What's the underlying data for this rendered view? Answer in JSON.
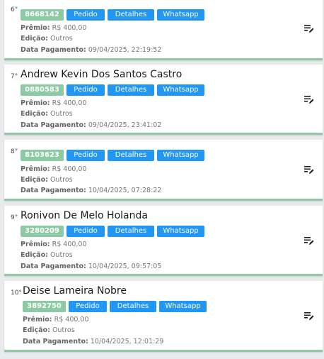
{
  "labels": {
    "premio": "Prêmio:",
    "edicao": "Edição:",
    "data_pagamento": "Data Pagamento:"
  },
  "buttons": {
    "pedido": "Pedido",
    "detalhes": "Detalhes",
    "whatsapp": "Whatsapp"
  },
  "colors": {
    "code_chip": "#8ccaa4",
    "button": "#2196f3",
    "card_border": "#8fc9a6"
  },
  "entries": [
    {
      "rank": "6°",
      "name": "",
      "code": "8668142",
      "premio": "R$ 400,00",
      "edicao": "Outros",
      "data_pagamento": "09/04/2025, 22:19:52"
    },
    {
      "rank": "7°",
      "name": "Andrew Kevin Dos Santos Castro",
      "code": "0880583",
      "premio": "R$ 400,00",
      "edicao": "Outros",
      "data_pagamento": "09/04/2025, 23:41:02"
    },
    {
      "rank": "8°",
      "name": "",
      "code": "8103623",
      "premio": "R$ 400,00",
      "edicao": "Outros",
      "data_pagamento": "10/04/2025, 07:28:22"
    },
    {
      "rank": "9°",
      "name": "Ronivon De Melo Holanda",
      "code": "3280209",
      "premio": "R$ 400,00",
      "edicao": "Outros",
      "data_pagamento": "10/04/2025, 09:57:05"
    },
    {
      "rank": "10°",
      "name": "Deise Lameira Nobre",
      "code": "3892750",
      "premio": "R$ 400,00",
      "edicao": "Outros",
      "data_pagamento": "10/04/2025, 12:01:29"
    }
  ]
}
